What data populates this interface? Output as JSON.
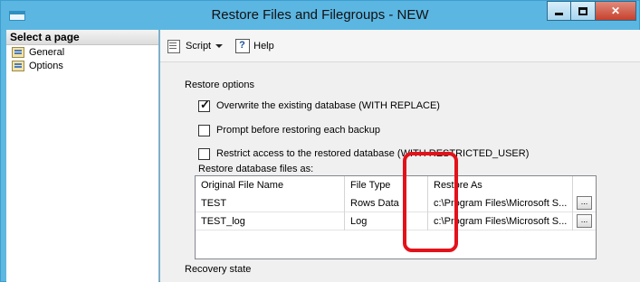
{
  "window": {
    "title": "Restore Files and Filegroups - NEW"
  },
  "left_pane": {
    "header": "Select a page",
    "items": [
      "General",
      "Options"
    ]
  },
  "toolbar": {
    "script_label": "Script",
    "help_label": "Help"
  },
  "options": {
    "section_label": "Restore options",
    "checkboxes": [
      {
        "label": "Overwrite the existing database (WITH REPLACE)",
        "checked": true
      },
      {
        "label": "Prompt before restoring each backup",
        "checked": false
      },
      {
        "label": "Restrict access to the restored database (WITH RESTRICTED_USER)",
        "checked": false
      }
    ],
    "files_label": "Restore database files as:",
    "grid": {
      "columns": [
        "Original File Name",
        "File Type",
        "Restore As"
      ],
      "rows": [
        {
          "original": "TEST",
          "type": "Rows Data",
          "restore_as": "c:\\Program Files\\Microsoft S...",
          "button": "..."
        },
        {
          "original": "TEST_log",
          "type": "Log",
          "restore_as": "c:\\Program Files\\Microsoft S...",
          "button": "..."
        }
      ]
    },
    "recovery_label": "Recovery state"
  },
  "colors": {
    "titlebar": "#5cb6e2",
    "highlight": "#e3121a",
    "close_button": "#c7412c"
  }
}
